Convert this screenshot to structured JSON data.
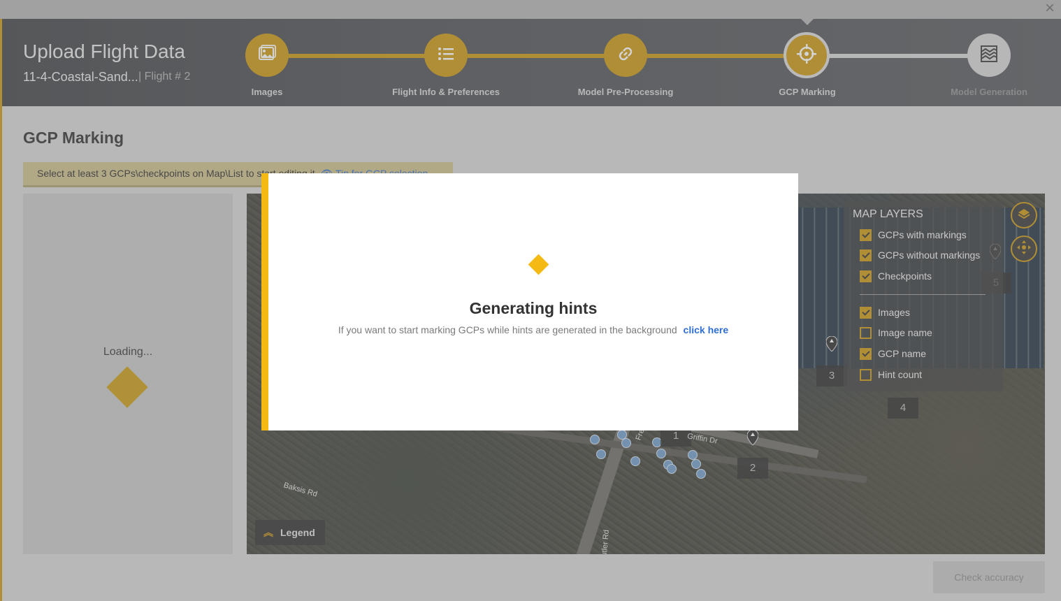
{
  "header": {
    "title": "Upload Flight Data",
    "project_name": "11-4-Coastal-Sand...",
    "flight_number": "| Flight # 2",
    "close_label": "×"
  },
  "steps": [
    {
      "label": "Images",
      "icon": "image-icon",
      "state": "done"
    },
    {
      "label": "Flight Info & Preferences",
      "icon": "list-icon",
      "state": "done"
    },
    {
      "label": "Model Pre-Processing",
      "icon": "link-icon",
      "state": "done"
    },
    {
      "label": "GCP Marking",
      "icon": "crosshair-icon",
      "state": "active"
    },
    {
      "label": "Model Generation",
      "icon": "layers-stack-icon",
      "state": "pending"
    }
  ],
  "page": {
    "title": "GCP Marking",
    "instruction": "Select at least 3 GCPs\\checkpoints on Map\\List to start editing it",
    "tip_link": "Tip for GCP selection"
  },
  "left_panel": {
    "loading_text": "Loading..."
  },
  "map": {
    "layers_title": "MAP LAYERS",
    "layers": [
      {
        "label": "GCPs with markings",
        "checked": true
      },
      {
        "label": "GCPs without markings",
        "checked": true
      },
      {
        "label": "Checkpoints",
        "checked": true
      },
      {
        "label": "Images",
        "checked": true
      },
      {
        "label": "Image name",
        "checked": false
      },
      {
        "label": "GCP name",
        "checked": true
      },
      {
        "label": "Hint count",
        "checked": false
      }
    ],
    "gcp_labels": [
      "1",
      "2",
      "3",
      "4",
      "5"
    ],
    "street_labels": [
      "Baksis Rd",
      "Griffin Dr",
      "Freeman Rd",
      "Butler Rd"
    ],
    "legend_label": "Legend"
  },
  "footer": {
    "check_accuracy_label": "Check accuracy"
  },
  "modal": {
    "title": "Generating hints",
    "text": "If you want to start marking GCPs while hints are generated in the background",
    "link": "click here"
  },
  "colors": {
    "accent": "#c9960f",
    "modal_accent": "#f5b914",
    "link": "#2f6fd1"
  }
}
